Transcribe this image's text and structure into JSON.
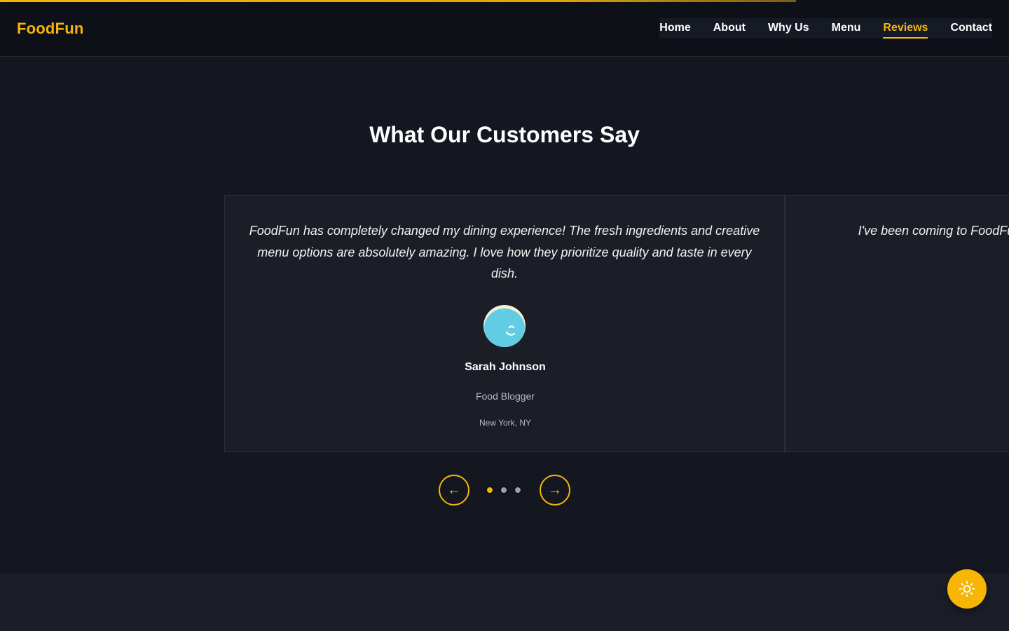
{
  "progress": {
    "fraction": 0.789
  },
  "header": {
    "logo": "FoodFun",
    "nav": [
      {
        "label": "Home",
        "active": false
      },
      {
        "label": "About",
        "active": false
      },
      {
        "label": "Why Us",
        "active": false
      },
      {
        "label": "Menu",
        "active": false
      },
      {
        "label": "Reviews",
        "active": true
      },
      {
        "label": "Contact",
        "active": false
      }
    ]
  },
  "reviews": {
    "title": "What Our Customers Say",
    "cards": [
      {
        "quote": "FoodFun has completely changed my dining experience! The fresh ingredients and creative menu options are absolutely amazing. I love how they prioritize quality and taste in every dish.",
        "name": "Sarah Johnson",
        "role": "Food Blogger",
        "location": "New York, NY",
        "avatar_icon": "smiling-face-avatar-icon"
      },
      {
        "quote": "I've been coming to FoodFun for o… service is fast, the food is always fr…"
      }
    ],
    "controls": {
      "prev_label": "←",
      "next_label": "→",
      "dots": 3,
      "active_dot": 1
    }
  },
  "theme_toggle": {
    "icon": "sun-icon"
  },
  "colors": {
    "accent": "#f5b50a",
    "background": "#141720",
    "header_bg": "#0e1017",
    "card_bg": "#1b1e27"
  }
}
